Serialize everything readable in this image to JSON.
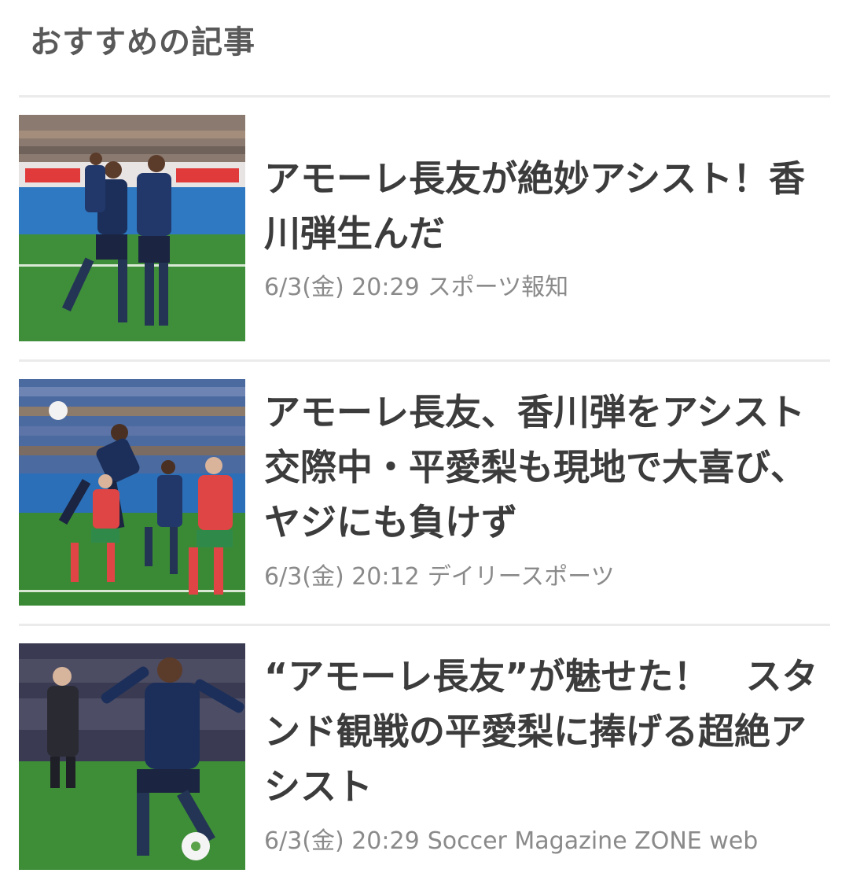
{
  "section": {
    "title": "おすすめの記事"
  },
  "articles": [
    {
      "title": "アモーレ長友が絶妙アシスト！香川弾生んだ",
      "date": "6/3(金) 20:29",
      "source": "スポーツ報知",
      "image": "soccer-players-celebrating-photo"
    },
    {
      "title": "アモーレ長友、香川弾をアシスト　交際中・平愛梨も現地で大喜び、ヤジにも負けず",
      "date": "6/3(金) 20:12",
      "source": "デイリースポーツ",
      "image": "soccer-header-photo"
    },
    {
      "title": "“アモーレ長友”が魅せた！　スタンド観戦の平愛梨に捧げる超絶アシスト",
      "date": "6/3(金) 20:29",
      "source": "Soccer Magazine ZONE web",
      "image": "soccer-player-kicking-photo"
    }
  ],
  "colors": {
    "title_text": "#3c3c3c",
    "meta_text": "#8a8a8a",
    "divider": "#ebebeb"
  }
}
